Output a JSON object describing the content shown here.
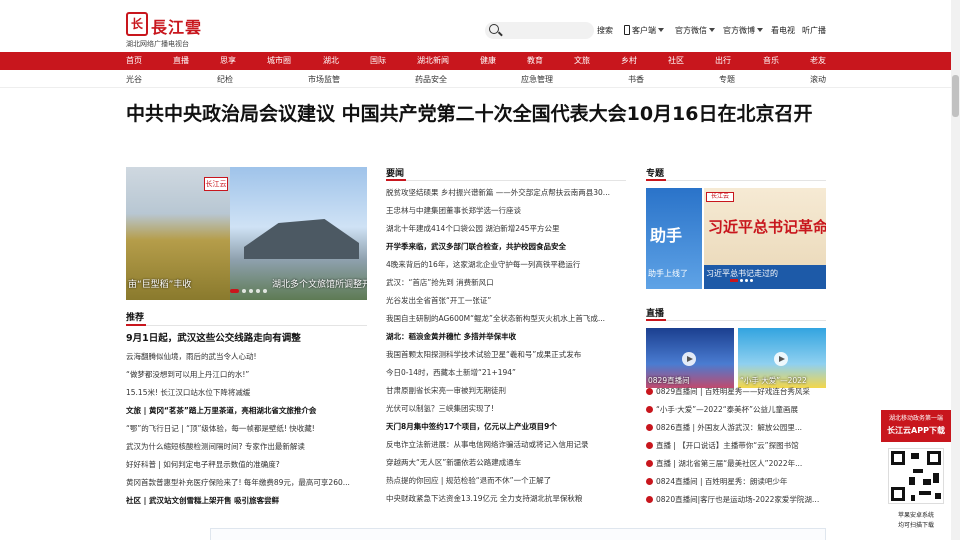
{
  "brand": {
    "logo_char": "长",
    "name": "長江雲",
    "subtitle": "湖北网络广播电视台",
    "color": "#c8161d"
  },
  "search": {
    "placeholder": "",
    "button": "搜索"
  },
  "top_links": [
    {
      "label": "客户端",
      "dropdown": true,
      "icon": "phone-icon"
    },
    {
      "label": "官方微信",
      "dropdown": true
    },
    {
      "label": "官方微博",
      "dropdown": true
    },
    {
      "label": "看电视",
      "dropdown": false
    },
    {
      "label": "听广播",
      "dropdown": false
    }
  ],
  "nav_main": [
    "首页",
    "直播",
    "思享",
    "城市圈",
    "湖北",
    "国际",
    "湖北新闻",
    "健康",
    "教育",
    "文旅",
    "乡村",
    "社区",
    "出行",
    "音乐",
    "老友"
  ],
  "nav_sub": [
    "光谷",
    "纪检",
    "市场监管",
    "药品安全",
    "应急管理",
    "书香",
    "专题",
    "滚动"
  ],
  "headline": "中共中央政治局会议建议 中国共产党第二十次全国代表大会10月16日在北京召开",
  "slider": {
    "caption_left": "亩“巨型稻”丰收",
    "caption_right": "湖北多个文旅馆所调整开",
    "logo": "长江云"
  },
  "recommend": {
    "title": "推荐",
    "items": [
      {
        "text": "9月1日起，武汉这些公交线路走向有调整",
        "style": "big"
      },
      {
        "text": "云海翻腾似仙境，雨后的武当令人心动!",
        "style": ""
      },
      {
        "text": "“做梦都没想到可以用上丹江口的水!”",
        "style": ""
      },
      {
        "text": "15.15米! 长江汉口站水位下降将减缓",
        "style": ""
      },
      {
        "text": "文旅 | 黄冈“茗茶”踏上万里茶道，亮相湖北省文旅推介会",
        "style": "b"
      },
      {
        "text": "“鄂”的飞行日记 | “顶”级体验，每一帧都是壁纸! 快收藏!",
        "style": ""
      },
      {
        "text": "武汉为什么缩短核酸检测间隔时间? 专家作出最新解读",
        "style": ""
      },
      {
        "text": "好好科普 | 如何判定电子秤显示数值的准确度?",
        "style": ""
      },
      {
        "text": "黄冈首款普惠型补充医疗保险来了! 每年缴费89元，最高可享260...",
        "style": ""
      },
      {
        "text": "社区 | 武汉站文创雪糕上架开售 吸引旅客尝鲜",
        "style": "b"
      }
    ]
  },
  "news": {
    "title": "要闻",
    "items": [
      {
        "text": "脱贫攻坚结硕果 乡村振兴谱新篇 ——外交部定点帮扶云南两县30...",
        "style": ""
      },
      {
        "text": "王忠林与中建集团董事长郑学选一行座谈",
        "style": ""
      },
      {
        "text": "湖北十年建成414个口袋公园 湖泊新增245平方公里",
        "style": ""
      },
      {
        "text": "开学季来临，武汉多部门联合检查，共护校园食品安全",
        "style": "b"
      },
      {
        "text": "4晚来背后的16年，这家湖北企业守护每一列高铁平稳运行",
        "style": ""
      },
      {
        "text": "武汉：“首店”抢先到 消费新风口",
        "style": ""
      },
      {
        "text": "光谷发出全省首张“开工一张证”",
        "style": ""
      },
      {
        "text": "我国自主研制的AG600M“鲲龙”全状态新构型灭火机水上首飞成...",
        "style": ""
      },
      {
        "text": "湖北：稻浪金黄并穗忙 多措并举保丰收",
        "style": "b"
      },
      {
        "text": "我国首颗太阳探测科学技术试验卫星“羲和号”成果正式发布",
        "style": ""
      },
      {
        "text": "今日0-14时，西藏本土新增“21+194”",
        "style": ""
      },
      {
        "text": "甘肃原副省长宋亮一审被判无期徒刑",
        "style": ""
      },
      {
        "text": "光伏可以制氢？三峡集团实现了!",
        "style": ""
      },
      {
        "text": "天门8月集中签约17个项目，亿元以上产业项目9个",
        "style": "b"
      },
      {
        "text": "反电诈立法新进展：从事电信网络诈骗活动或将记入信用记录",
        "style": ""
      },
      {
        "text": "穿越两大“无人区”新疆依若公路建成通车",
        "style": ""
      },
      {
        "text": "热点提的你回应 | 规范检验“退而不休”一个正解了",
        "style": ""
      },
      {
        "text": "中央财政紧急下达资金13.19亿元 全力支持湖北抗旱保秋粮",
        "style": ""
      }
    ]
  },
  "special": {
    "title": "专题",
    "left_caption": "助手上线了",
    "right_caption": "习近平总书记走过的",
    "right_banner": "习近平总书记革命纪"
  },
  "live": {
    "title": "直播",
    "thumbs": [
      {
        "caption": "0829直播间"
      },
      {
        "caption": "“小手·大爱”—2022"
      }
    ],
    "items": [
      {
        "text": "0829直播间 | 百姓明星秀——好戏连台秀风采"
      },
      {
        "text": "“小手·大爱”—2022“泰美杯”公益儿童画展"
      },
      {
        "text": "0826直播 | 外国友人游武汉：解放公园里..."
      },
      {
        "text": "直播 | 【开口说话】主播带你“云”探图书馆"
      },
      {
        "text": "直播 | 湖北省第三届“最美社区人”2022年..."
      },
      {
        "text": "0824直播间 | 百姓明星秀：朗读吧少年"
      },
      {
        "text": "0820直播间|客厅也是运动场-2022家爱学院湖北..."
      }
    ]
  },
  "app_download": {
    "line1": "湖北移动政务第一端",
    "line2": "长江云APP下载",
    "line3": "苹果安卓系统",
    "line4": "均可扫描下载"
  }
}
